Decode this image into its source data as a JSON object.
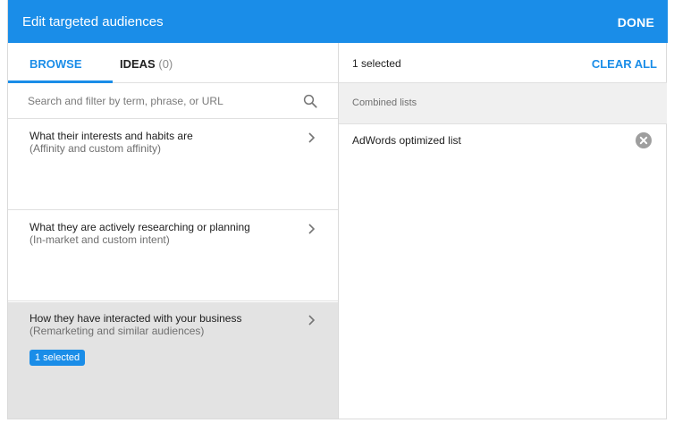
{
  "header": {
    "title": "Edit targeted audiences",
    "done_label": "DONE"
  },
  "tabs": [
    {
      "label": "BROWSE",
      "active": true
    },
    {
      "label": "IDEAS",
      "count": "(0)",
      "active": false
    }
  ],
  "search": {
    "placeholder": "Search and filter by term, phrase, or URL",
    "value": "",
    "icon": "search-icon"
  },
  "categories": [
    {
      "title": "What their interests and habits are",
      "subtitle": "(Affinity and custom affinity)",
      "icon": "chevron-right-icon"
    },
    {
      "title": "What they are actively researching or planning",
      "subtitle": "(In-market and custom intent)",
      "icon": "chevron-right-icon"
    },
    {
      "title": "How they have interacted with your business",
      "subtitle": "(Remarketing and similar audiences)",
      "badge": "1 selected",
      "selected": true,
      "icon": "chevron-right-icon"
    }
  ],
  "selection": {
    "count_label": "1 selected",
    "clear_label": "CLEAR ALL",
    "group_label": "Combined lists",
    "items": [
      {
        "name": "AdWords optimized list",
        "icon": "remove-icon"
      }
    ]
  },
  "colors": {
    "accent": "#1a8de8",
    "selected_row": "#e3e3e3",
    "group_bg": "#f0f0f0"
  }
}
